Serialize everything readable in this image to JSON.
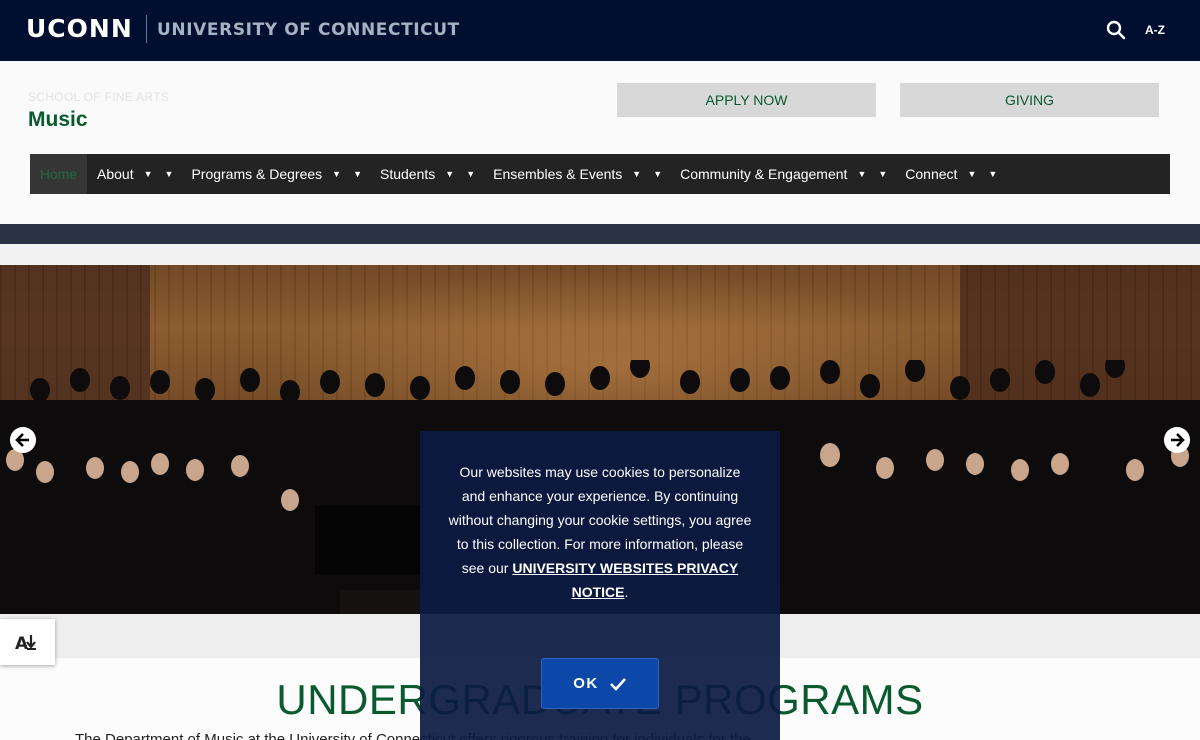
{
  "topbar": {
    "logo": "UCONN",
    "university": "UNIVERSITY OF CONNECTICUT",
    "az": "A-Z"
  },
  "header": {
    "school": "SCHOOL OF FINE ARTS",
    "title": "Music",
    "apply": "APPLY NOW",
    "giving": "GIVING"
  },
  "nav": {
    "home": "Home",
    "items": [
      {
        "label": "About"
      },
      {
        "label": "Programs & Degrees"
      },
      {
        "label": "Students"
      },
      {
        "label": "Ensembles & Events"
      },
      {
        "label": "Community & Engagement"
      },
      {
        "label": "Connect"
      }
    ]
  },
  "main": {
    "heading": "UNDERGRADUATE PROGRAMS",
    "intro": "The Department of Music at the University of Connecticut offers rigorous training for individuals for the"
  },
  "cookie": {
    "text1": "Our websites may use cookies to personalize and enhance your experience. By continuing without changing your cookie settings, you agree to this collection. For more information, please see our",
    "link": "UNIVERSITY WEBSITES PRIVACY NOTICE",
    "text2": ".",
    "ok": "OK"
  },
  "colors": {
    "navy": "#000e2f",
    "green": "#0a5a30",
    "cookie_bg": "#0c1b44",
    "ok_bg": "#0b48a8"
  },
  "icons": [
    "search-icon",
    "arrow-left-icon",
    "arrow-right-icon",
    "accessibility-download-icon",
    "checkmark-icon",
    "caret-down-icon"
  ]
}
